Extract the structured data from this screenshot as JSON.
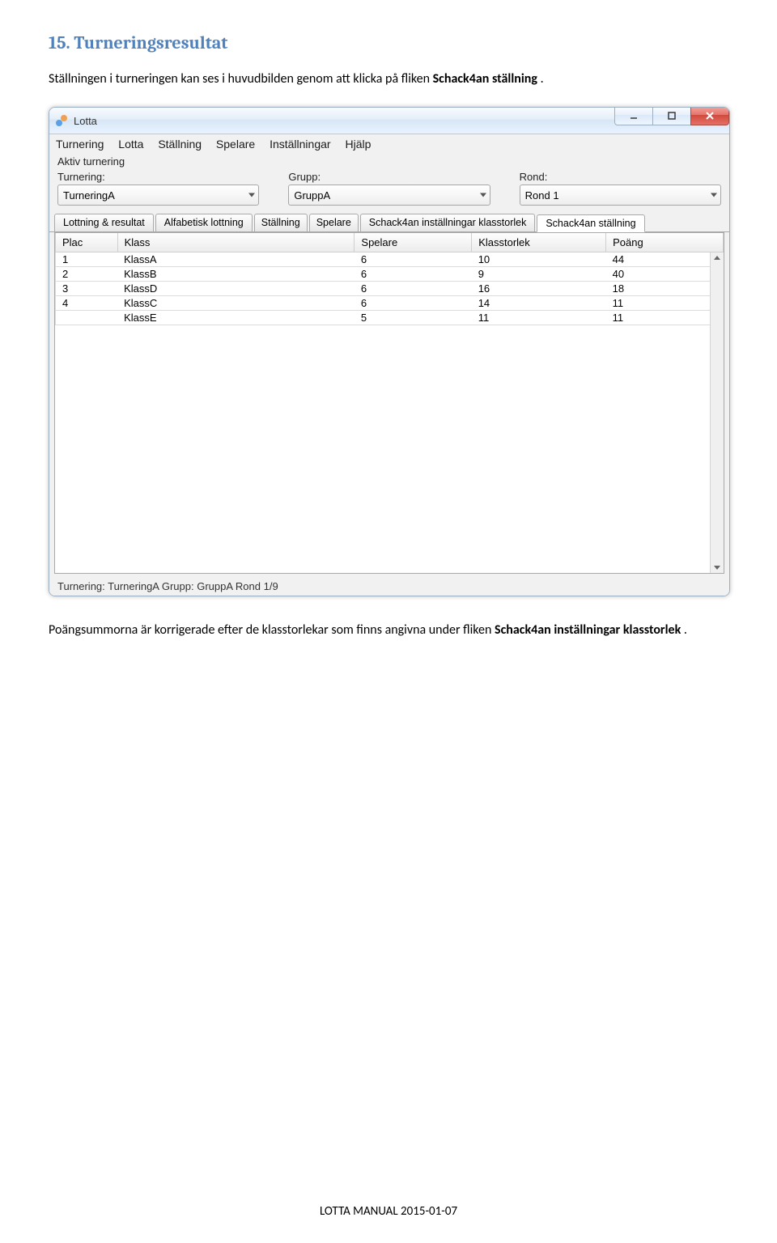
{
  "doc": {
    "heading": "15. Turneringsresultat",
    "para1_parts": [
      "Ställningen i turneringen kan ses i huvudbilden genom att klicka på fliken ",
      "Schack4an ställning",
      "."
    ],
    "para2_parts": [
      "Poängsummorna är korrigerade efter de klasstorlekar som finns angivna under fliken ",
      "Schack4an inställningar klasstorlek",
      "."
    ],
    "footer": "LOTTA MANUAL 2015-01-07"
  },
  "app": {
    "title": "Lotta",
    "menubar": [
      "Turnering",
      "Lotta",
      "Ställning",
      "Spelare",
      "Inställningar",
      "Hjälp"
    ],
    "active_label": "Aktiv turnering",
    "selectors": {
      "turnering": {
        "label": "Turnering:",
        "value": "TurneringA"
      },
      "grupp": {
        "label": "Grupp:",
        "value": "GruppA"
      },
      "rond": {
        "label": "Rond:",
        "value": "Rond 1"
      }
    },
    "tabs": [
      "Lottning & resultat",
      "Alfabetisk lottning",
      "Ställning",
      "Spelare",
      "Schack4an inställningar klasstorlek",
      "Schack4an ställning"
    ],
    "active_tab_index": 5,
    "columns": [
      "Plac",
      "Klass",
      "Spelare",
      "Klasstorlek",
      "Poäng"
    ],
    "rows": [
      {
        "plac": "1",
        "klass": "KlassA",
        "spelare": "6",
        "klasstorlek": "10",
        "poang": "44"
      },
      {
        "plac": "2",
        "klass": "KlassB",
        "spelare": "6",
        "klasstorlek": "9",
        "poang": "40"
      },
      {
        "plac": "3",
        "klass": "KlassD",
        "spelare": "6",
        "klasstorlek": "16",
        "poang": "18"
      },
      {
        "plac": "4",
        "klass": "KlassC",
        "spelare": "6",
        "klasstorlek": "14",
        "poang": "11"
      },
      {
        "plac": "",
        "klass": "KlassE",
        "spelare": "5",
        "klasstorlek": "11",
        "poang": "11"
      }
    ],
    "statusbar": "Turnering: TurneringA  Grupp: GruppA  Rond 1/9"
  }
}
